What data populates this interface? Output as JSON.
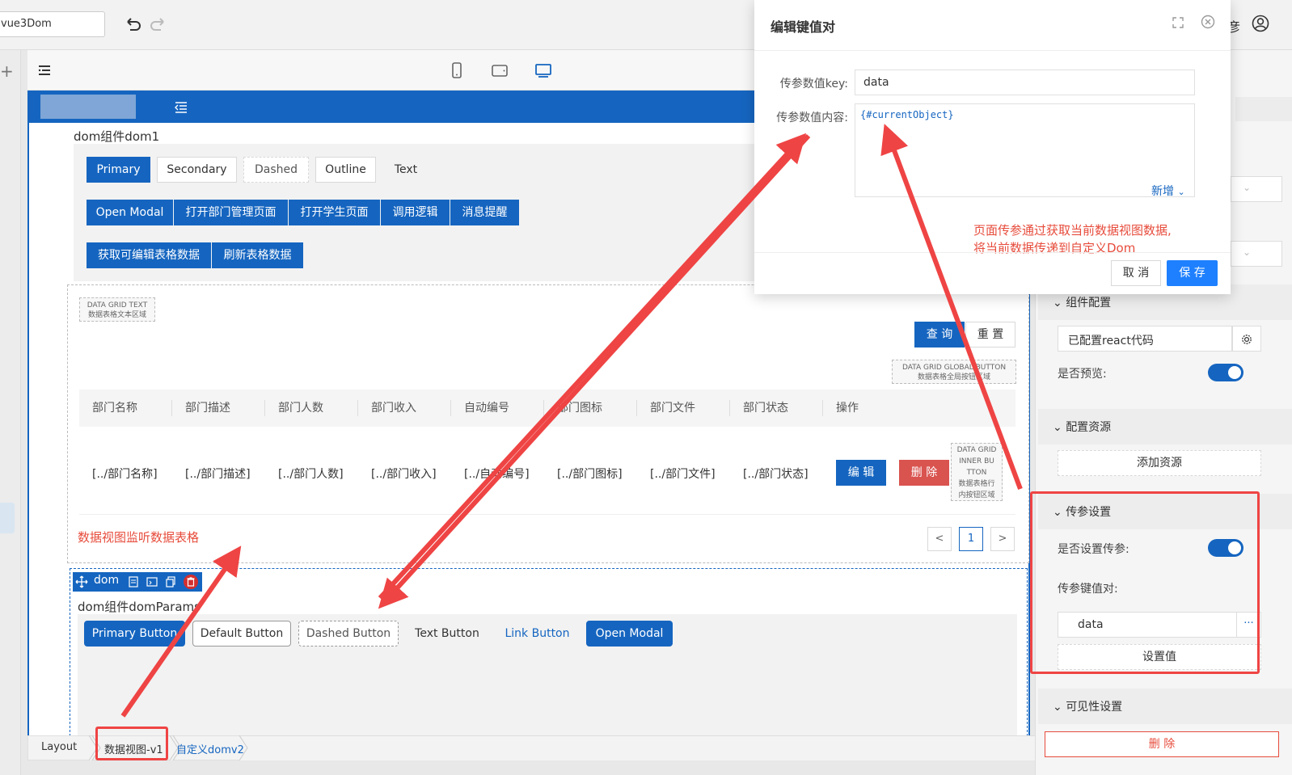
{
  "topbar": {
    "app_name": "vue3Dom",
    "user_partial": "彦"
  },
  "canvas": {
    "dom1_title": "dom组件dom1",
    "dom1_row1": [
      "Primary",
      "Secondary",
      "Dashed",
      "Outline",
      "Text"
    ],
    "dom1_row2": [
      "Open Modal",
      "打开部门管理页面",
      "打开学生页面",
      "调用逻辑",
      "消息提醒"
    ],
    "dom1_row3": [
      "获取可编辑表格数据",
      "刷新表格数据"
    ]
  },
  "grid": {
    "text_tag": [
      "DATA GRID TEXT",
      "数据表格文本区域"
    ],
    "query_btn": "查 询",
    "reset_btn": "重 置",
    "global_tag": [
      "DATA GRID GLOBAL BUTTON",
      "数据表格全局按钮区域"
    ],
    "headers": [
      "部门名称",
      "部门描述",
      "部门人数",
      "部门收入",
      "自动编号",
      "部门图标",
      "部门文件",
      "部门状态",
      "操作"
    ],
    "row": [
      "[../部门名称]",
      "[../部门描述]",
      "[../部门人数]",
      "[../部门收入]",
      "[../自动编号]",
      "[../部门图标]",
      "[../部门文件]",
      "[../部门状态]"
    ],
    "edit_btn": "编 辑",
    "delete_btn": "删 除",
    "inner_tag": [
      "DATA GRID",
      "INNER BU",
      "TTON",
      "数据表格行",
      "内按钮区域"
    ],
    "page_current": "1",
    "prev_glyph": "<",
    "next_glyph": ">"
  },
  "annotation": {
    "listen": "数据视图监听数据表格",
    "note_line1": "页面传参通过获取当前数据视图数据,",
    "note_line2": "将当前数据传递到自定义Dom"
  },
  "dom2": {
    "toolbar_label": "dom",
    "title": "dom组件domParams",
    "buttons": [
      "Primary Button",
      "Default Button",
      "Dashed Button",
      "Text Button",
      "Link Button",
      "Open Modal"
    ]
  },
  "breadcrumb": [
    "Layout",
    "数据视图-v1",
    "自定义domv2"
  ],
  "right_panel": {
    "component_config": "组件配置",
    "react_code": "已配置react代码",
    "preview_label": "是否预览:",
    "resources": "配置资源",
    "add_resource": "添加资源",
    "params": "传参设置",
    "set_params_label": "是否设置传参:",
    "kv_label": "传参键值对:",
    "kv_value": "data",
    "more_glyph": "···",
    "set_value_btn": "设置值",
    "visibility": "可见性设置",
    "delete_btn": "删 除"
  },
  "modal": {
    "title": "编辑键值对",
    "key_label": "传参数值key:",
    "key_value": "data",
    "content_label": "传参数值内容:",
    "content_value": "{#currentObject}",
    "add_link": "新增",
    "cancel": "取 消",
    "save": "保 存"
  },
  "colors": {
    "brand": "#1565c0",
    "annotation_red": "#ef4444",
    "save_blue": "#1e80ff"
  }
}
